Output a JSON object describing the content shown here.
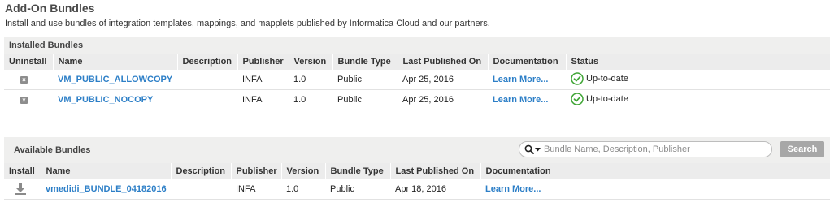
{
  "page": {
    "title": "Add-On Bundles",
    "subtitle": "Install and use bundles of integration templates, mappings, and mapplets published by Informatica Cloud and our partners."
  },
  "installed": {
    "header": "Installed Bundles",
    "columns": [
      "Uninstall",
      "Name",
      "Description",
      "Publisher",
      "Version",
      "Bundle Type",
      "Last Published On",
      "Documentation",
      "Status"
    ],
    "rows": [
      {
        "name": "VM_PUBLIC_ALLOWCOPY",
        "description": "",
        "publisher": "INFA",
        "version": "1.0",
        "bundle_type": "Public",
        "last_published": "Apr 25, 2016",
        "documentation": "Learn More...",
        "status": "Up-to-date"
      },
      {
        "name": "VM_PUBLIC_NOCOPY",
        "description": "",
        "publisher": "INFA",
        "version": "1.0",
        "bundle_type": "Public",
        "last_published": "Apr 25, 2016",
        "documentation": "Learn More...",
        "status": "Up-to-date"
      }
    ]
  },
  "available": {
    "header": "Available Bundles",
    "search_placeholder": "Bundle Name, Description, Publisher",
    "search_button": "Search",
    "columns": [
      "Install",
      "Name",
      "Description",
      "Publisher",
      "Version",
      "Bundle Type",
      "Last Published On",
      "Documentation"
    ],
    "rows": [
      {
        "name": "vmedidi_BUNDLE_04182016",
        "description": "",
        "publisher": "INFA",
        "version": "1.0",
        "bundle_type": "Public",
        "last_published": "Apr 18, 2016",
        "documentation": "Learn More..."
      }
    ]
  },
  "icons": {
    "uninstall": "uninstall-x-icon",
    "status_ok": "check-circle-icon",
    "install": "download-icon",
    "search": "search-icon"
  },
  "colors": {
    "link": "#2d7fc7",
    "status_ok": "#3fa535",
    "header_bg": "#efefee",
    "search_button_bg": "#a7a7a7"
  }
}
